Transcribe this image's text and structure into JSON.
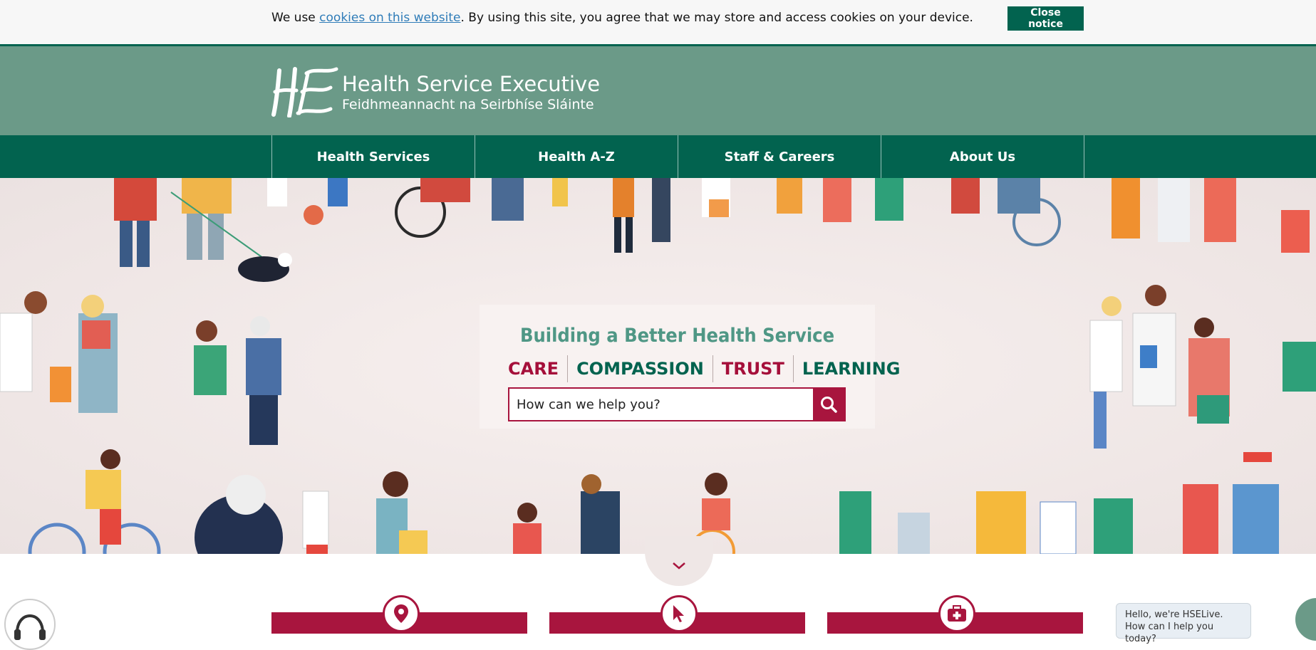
{
  "cookie": {
    "prefix": "We use ",
    "link": "cookies on this website",
    "suffix": ". By using this site, you agree that we may store and access cookies on your device.",
    "close_label": "Close notice"
  },
  "header": {
    "title": "Health Service Executive",
    "subtitle": "Feidhmeannacht na Seirbhíse Sláinte"
  },
  "nav": {
    "items": [
      {
        "label": "Health Services"
      },
      {
        "label": "Health A-Z"
      },
      {
        "label": "Staff & Careers"
      },
      {
        "label": "About Us"
      }
    ]
  },
  "hero": {
    "tagline": "Building a Better Health Service",
    "values": [
      "CARE",
      "COMPASSION",
      "TRUST",
      "LEARNING"
    ],
    "search_placeholder": "How can we help you?"
  },
  "chat": {
    "greeting": "Hello, we're HSELive. How can I help you today?"
  },
  "colors": {
    "brand_green": "#02634f",
    "header_green": "#6b9a88",
    "accent_red": "#a8153e",
    "tagline_green": "#4f9785"
  },
  "icons": {
    "search": "magnifier-icon",
    "scroll": "chevron-down-icon",
    "cards": [
      "location-pin-icon",
      "cursor-icon",
      "medical-kit-icon"
    ],
    "listen": "headphones-icon"
  }
}
